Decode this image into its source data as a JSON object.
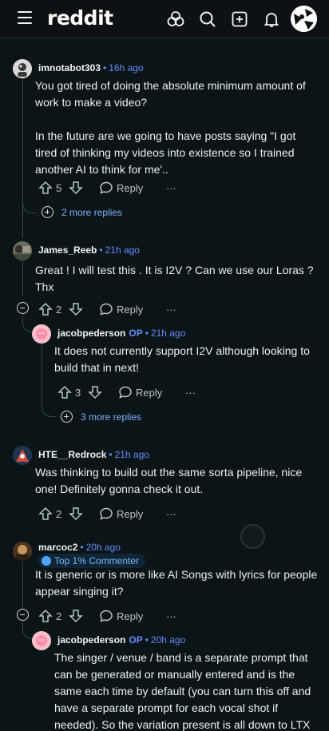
{
  "header": {
    "logo": "reddit",
    "icons": [
      "menu-icon",
      "popular-icon",
      "search-icon",
      "create-post-icon",
      "notifications-icon",
      "user-avatar"
    ]
  },
  "actions": {
    "reply": "Reply",
    "overflow": "···"
  },
  "comments": [
    {
      "user": "imnotabot303",
      "time": "16h ago",
      "paragraphs": [
        "You got tired of doing the absolute minimum amount of work to make a video?",
        "In the future are we going to have posts saying \"I got tired of thinking my videos into existence so I trained another AI to think for me'.."
      ],
      "votes": "5",
      "more_replies": "2 more replies"
    },
    {
      "user": "James_Reeb",
      "time": "21h ago",
      "paragraphs": [
        "Great ! I will test this . It is I2V ? Can we use our Loras ? Thx"
      ],
      "votes": "2"
    },
    {
      "user": "jacobpederson",
      "op": "OP",
      "time": "21h ago",
      "paragraphs": [
        "It does not currently support I2V although looking to build that in next!"
      ],
      "votes": "3",
      "more_replies": "3 more replies"
    },
    {
      "user": "HTE__Redrock",
      "time": "21h ago",
      "paragraphs": [
        "Was thinking to build out the same sorta pipeline, nice one! Definitely gonna check it out."
      ],
      "votes": "2"
    },
    {
      "user": "marcoc2",
      "time": "20h ago",
      "badge": "Top 1% Commenter",
      "paragraphs": [
        "It is generic or is more like AI Songs with lyrics for people appear singing it?"
      ],
      "votes": "2"
    },
    {
      "user": "jacobpederson",
      "op": "OP",
      "time": "20h ago",
      "paragraphs": [
        "The singer / venue / band is a separate prompt that can be generated or manually entered and is the same each time by default (you can turn this off and have a separate prompt for each vocal shot if needed). So the variation present is all down to LTX"
      ]
    }
  ],
  "colors": {
    "background": "#0b1416",
    "header": "#0e1113",
    "accent_blue": "#648efc",
    "link_blue": "#7fb3ff"
  }
}
